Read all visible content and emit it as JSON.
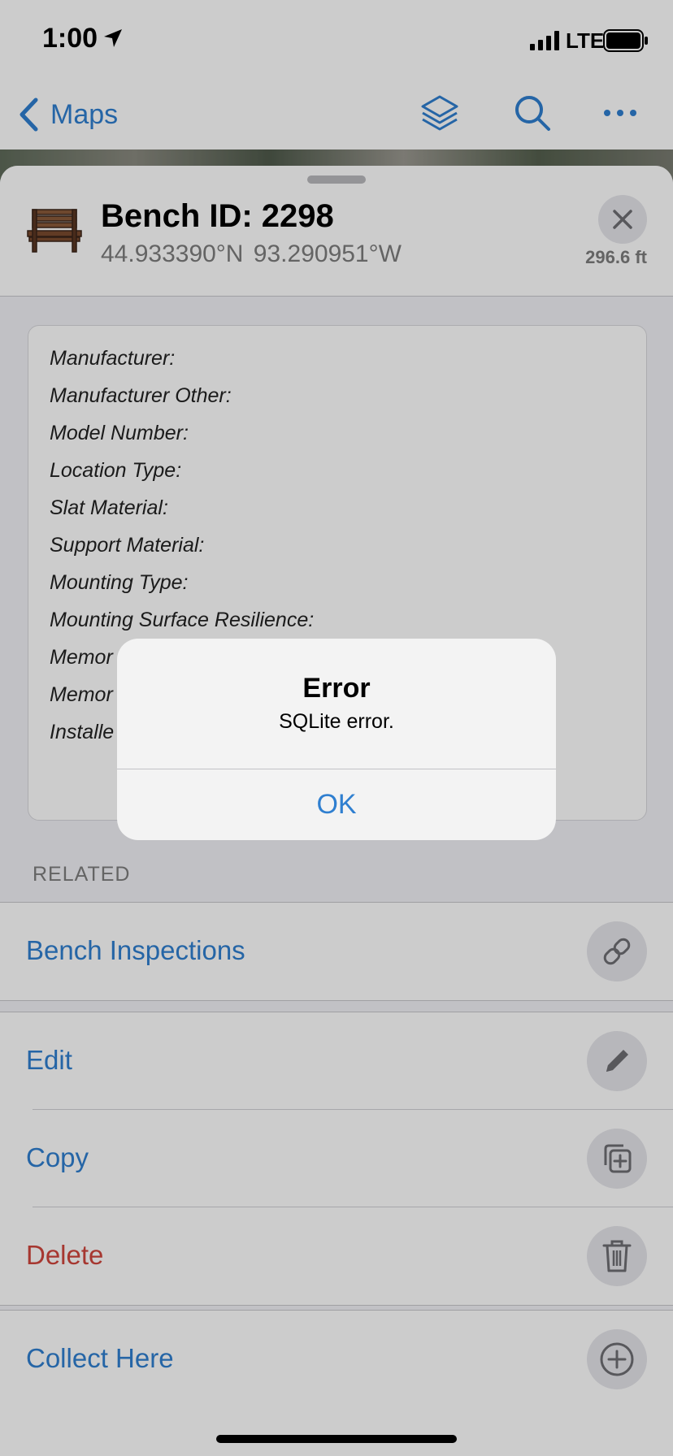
{
  "status_bar": {
    "time": "1:00",
    "network": "LTE"
  },
  "nav": {
    "back_label": "Maps"
  },
  "feature": {
    "title": "Bench ID: 2298",
    "coordinates": "44.933390°N  93.290951°W",
    "distance": "296.6 ft"
  },
  "attributes": [
    "Manufacturer:",
    "Manufacturer Other:",
    "Model Number:",
    "Location Type:",
    "Slat Material:",
    "Support Material:",
    "Mounting Type:",
    "Mounting Surface Resilience:",
    "Memor",
    "Memor",
    "Installe"
  ],
  "related": {
    "header": "RELATED",
    "items": [
      {
        "label": "Bench Inspections",
        "icon": "link-icon"
      }
    ]
  },
  "actions": [
    {
      "label": "Edit",
      "icon": "pencil-icon",
      "color": "#2f7fd0"
    },
    {
      "label": "Copy",
      "icon": "copy-icon",
      "color": "#2f7fd0"
    },
    {
      "label": "Delete",
      "icon": "trash-icon",
      "color": "#d0453d"
    }
  ],
  "collect": {
    "label": "Collect Here",
    "icon": "plus-circle-icon"
  },
  "alert": {
    "title": "Error",
    "message": "SQLite error.",
    "button": "OK"
  },
  "colors": {
    "accent": "#2f7fd0",
    "destructive": "#d0453d"
  }
}
